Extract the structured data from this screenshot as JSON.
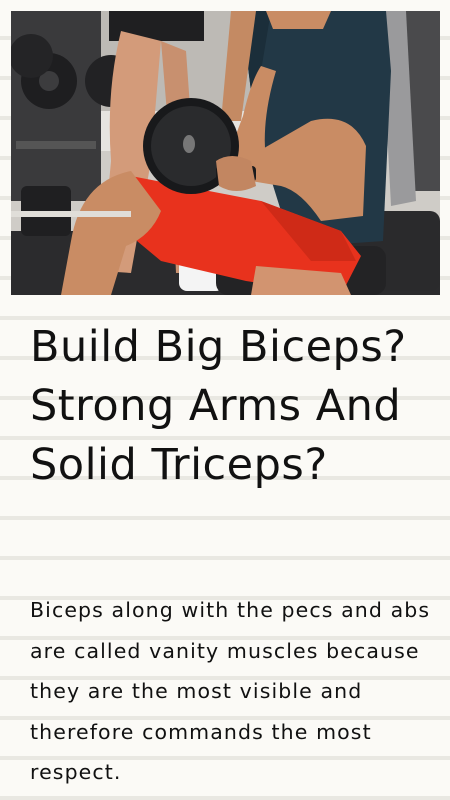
{
  "article": {
    "headline": "Build Big Biceps? Strong Arms And Solid Triceps?",
    "body": "Biceps along with the pecs and abs are called vanity muscles because they are the most visible and therefore commands the most respect."
  },
  "hero_image": {
    "subject": "man doing seated dumbbell curl in gym"
  },
  "colors": {
    "background": "#fbfaf6",
    "rule_lines": "#e9e8e2",
    "text": "#111111",
    "shorts": "#e8321d",
    "shirt": "#223846"
  }
}
